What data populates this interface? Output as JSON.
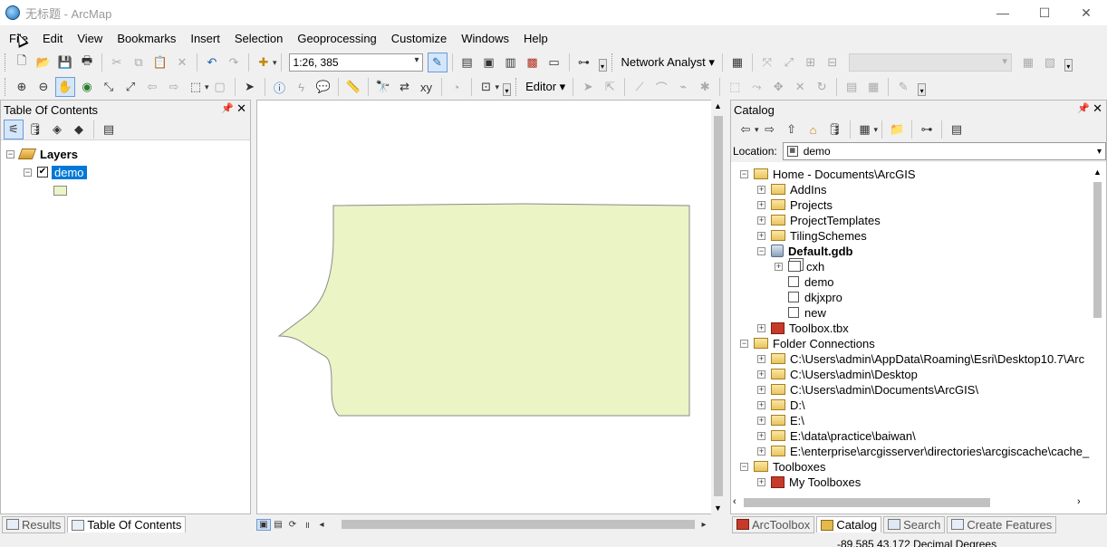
{
  "window": {
    "title": "无标题 - ArcMap",
    "controls": [
      "—",
      "☐",
      "✕"
    ]
  },
  "menu": [
    "File",
    "Edit",
    "View",
    "Bookmarks",
    "Insert",
    "Selection",
    "Geoprocessing",
    "Customize",
    "Windows",
    "Help"
  ],
  "toolbar": {
    "scale": "1:26, 385",
    "network_analyst": "Network Analyst",
    "editor": "Editor"
  },
  "toc": {
    "title": "Table Of Contents",
    "layers_label": "Layers",
    "layer_name": "demo",
    "layer_checked": true
  },
  "catalog": {
    "title": "Catalog",
    "location_label": "Location:",
    "location_value": "demo",
    "tree": [
      {
        "label": "Home - Documents\\ArcGIS",
        "level": 0,
        "exp": "⊟",
        "icon": "home-folder"
      },
      {
        "label": "AddIns",
        "level": 1,
        "exp": "⊞",
        "icon": "folder"
      },
      {
        "label": "Projects",
        "level": 1,
        "exp": "⊞",
        "icon": "folder"
      },
      {
        "label": "ProjectTemplates",
        "level": 1,
        "exp": "⊞",
        "icon": "folder"
      },
      {
        "label": "TilingSchemes",
        "level": 1,
        "exp": "⊞",
        "icon": "folder"
      },
      {
        "label": "Default.gdb",
        "level": 1,
        "exp": "⊟",
        "icon": "gdb",
        "bold": true
      },
      {
        "label": "cxh",
        "level": 2,
        "exp": "⊞",
        "icon": "dataset"
      },
      {
        "label": "demo",
        "level": 2,
        "exp": "",
        "icon": "featureclass"
      },
      {
        "label": "dkjxpro",
        "level": 2,
        "exp": "",
        "icon": "featureclass"
      },
      {
        "label": "new",
        "level": 2,
        "exp": "",
        "icon": "featureclass"
      },
      {
        "label": "Toolbox.tbx",
        "level": 1,
        "exp": "⊞",
        "icon": "toolbox"
      },
      {
        "label": "Folder Connections",
        "level": 0,
        "exp": "⊟",
        "icon": "folder"
      },
      {
        "label": "C:\\Users\\admin\\AppData\\Roaming\\Esri\\Desktop10.7\\Arc",
        "level": 1,
        "exp": "⊞",
        "icon": "folder"
      },
      {
        "label": "C:\\Users\\admin\\Desktop",
        "level": 1,
        "exp": "⊞",
        "icon": "folder"
      },
      {
        "label": "C:\\Users\\admin\\Documents\\ArcGIS\\",
        "level": 1,
        "exp": "⊞",
        "icon": "folder"
      },
      {
        "label": "D:\\",
        "level": 1,
        "exp": "⊞",
        "icon": "folder"
      },
      {
        "label": "E:\\",
        "level": 1,
        "exp": "⊞",
        "icon": "folder"
      },
      {
        "label": "E:\\data\\practice\\baiwan\\",
        "level": 1,
        "exp": "⊞",
        "icon": "folder"
      },
      {
        "label": "E:\\enterprise\\arcgisserver\\directories\\arcgiscache\\cache_",
        "level": 1,
        "exp": "⊞",
        "icon": "folder"
      },
      {
        "label": "Toolboxes",
        "level": 0,
        "exp": "⊟",
        "icon": "folder"
      },
      {
        "label": "My Toolboxes",
        "level": 1,
        "exp": "⊞",
        "icon": "toolbox"
      }
    ]
  },
  "toc_tabs": [
    "Results",
    "Table Of Contents"
  ],
  "catalog_tabs": [
    "ArcToolbox",
    "Catalog",
    "Search",
    "Create Features"
  ],
  "status": {
    "coordinates": "-89.585  43.172 Decimal Degrees"
  },
  "colors": {
    "polygon_fill": "#eaf4c5",
    "polygon_stroke": "#8a8a8a",
    "selection": "#0078d7"
  }
}
